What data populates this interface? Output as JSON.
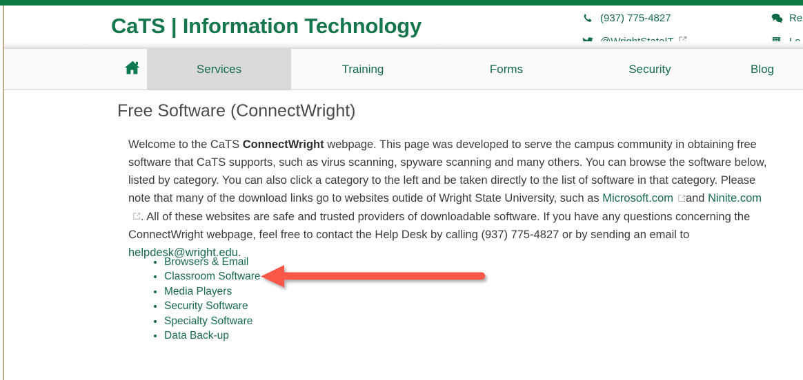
{
  "site": {
    "brand_title": "CaTS | Information Technology",
    "accent_green": "#16764b",
    "top_bar_color": "#0f7a43"
  },
  "header": {
    "contacts_left": [
      {
        "icon": "phone-icon",
        "text": "(937) 775-4827",
        "external": false
      },
      {
        "icon": "twitter-icon",
        "text": "@WrightStateIT",
        "external": true
      }
    ],
    "contacts_right": [
      {
        "icon": "chat-icon",
        "text": "Re",
        "external": false
      },
      {
        "icon": "building-icon",
        "text": "Lo",
        "external": false
      }
    ]
  },
  "nav": {
    "home_icon": "home-icon",
    "items": [
      {
        "label": "Services",
        "active": true
      },
      {
        "label": "Training",
        "active": false
      },
      {
        "label": "Forms",
        "active": false
      },
      {
        "label": "Security",
        "active": false
      },
      {
        "label": "Blog",
        "active": false
      }
    ]
  },
  "main": {
    "page_title": "Free Software (ConnectWright)",
    "paragraph": {
      "part1": "Welcome to the CaTS ",
      "bold1": "ConnectWright",
      "part2": " webpage. This page was developed to serve the campus community in obtaining free software that CaTS supports, such as virus scanning, spyware scanning and many others. You can browse the software below, listed by category. You can also click a category to the left and be taken directly to the list of software in that category. Please note that many of the download links go to websites outide of Wright State University, such as ",
      "link_microsoft": "Microsoft.com",
      "part3": "and ",
      "link_ninite": "Ninite.com",
      "part4": ". All of these websites are safe and trusted providers of downloadable software. If you have any questions concerning the ConnectWright webpage, feel free to contact the Help Desk by calling (937) 775-4827 or by sending an email to ",
      "link_email": "helpdesk@wright.edu",
      "part5": "."
    },
    "categories": [
      "Browsers & Email",
      "Classroom Software",
      "Media Players",
      "Security Software",
      "Specialty Software",
      "Data Back-up"
    ]
  },
  "annotation": {
    "type": "arrow",
    "direction": "left",
    "color": "#f9584a",
    "points_at": "Classroom Software"
  }
}
